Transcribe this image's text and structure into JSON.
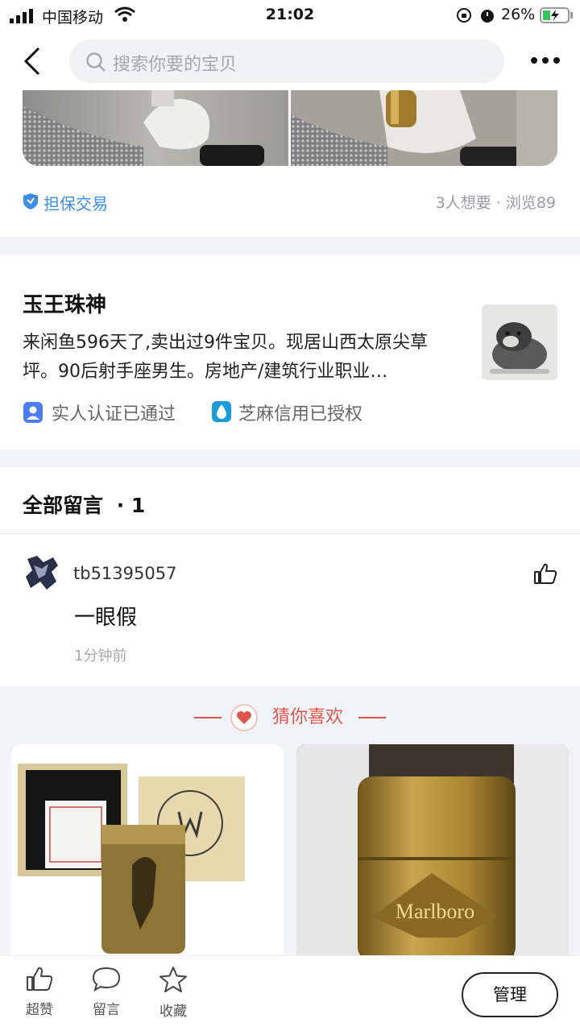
{
  "status_bar": {
    "carrier": "中国移动",
    "time": "21:02",
    "battery": "26%"
  },
  "nav": {
    "search_placeholder": "搜索你要的宝贝"
  },
  "trade": {
    "guarantee": "担保交易",
    "stats": "3人想要 · 浏览89"
  },
  "seller": {
    "name": "玉王珠神",
    "description": "来闲鱼596天了,卖出过9件宝贝。现居山西太原尖草坪。90后射手座男生。房地产/建筑行业职业…",
    "badges": [
      "实人认证已通过",
      "芝麻信用已授权"
    ]
  },
  "comments": {
    "header": "全部留言",
    "count": "· 1",
    "items": [
      {
        "user": "tb51395057",
        "text": "一眼假",
        "time": "1分钟前"
      }
    ]
  },
  "recommend": {
    "title": "猜你喜欢"
  },
  "bottom_bar": {
    "like": "超赞",
    "comment": "留言",
    "favorite": "收藏",
    "manage": "管理"
  },
  "colors": {
    "accent_blue": "#3a8ee6",
    "accent_red": "#e0554d"
  }
}
